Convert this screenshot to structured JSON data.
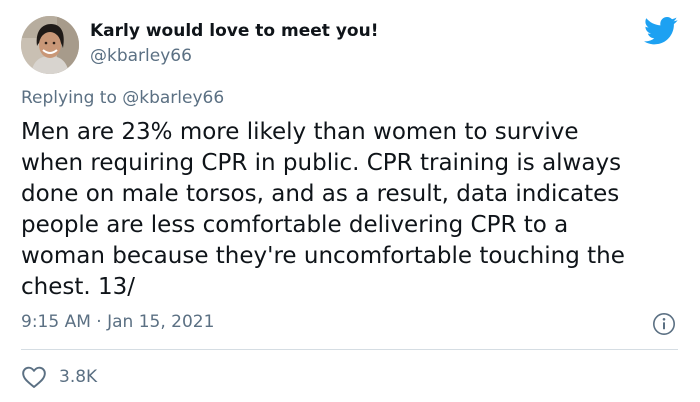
{
  "author": {
    "name": "Karly would love to meet you!",
    "handle": "@kbarley66"
  },
  "reply": {
    "prefix": "Replying to",
    "mention": "@kbarley66"
  },
  "tweet": {
    "lines": [
      "Men are 23% more likely than women to survive",
      "when requiring CPR in public. CPR training is always",
      "done on male torsos, and as a result, data indicates",
      "people are less comfortable delivering CPR to a",
      "woman because they're uncomfortable touching the",
      "chest. 13/"
    ],
    "time": "9:15 AM",
    "separator": "·",
    "date": "Jan 15, 2021"
  },
  "stats": {
    "likes": "3.8K"
  },
  "icons": {
    "brand": "twitter-bird-icon",
    "info": "info-icon",
    "like": "heart-icon"
  },
  "colors": {
    "brand": "#1da1f2",
    "muted": "#5b7083",
    "text": "#0f1419"
  }
}
